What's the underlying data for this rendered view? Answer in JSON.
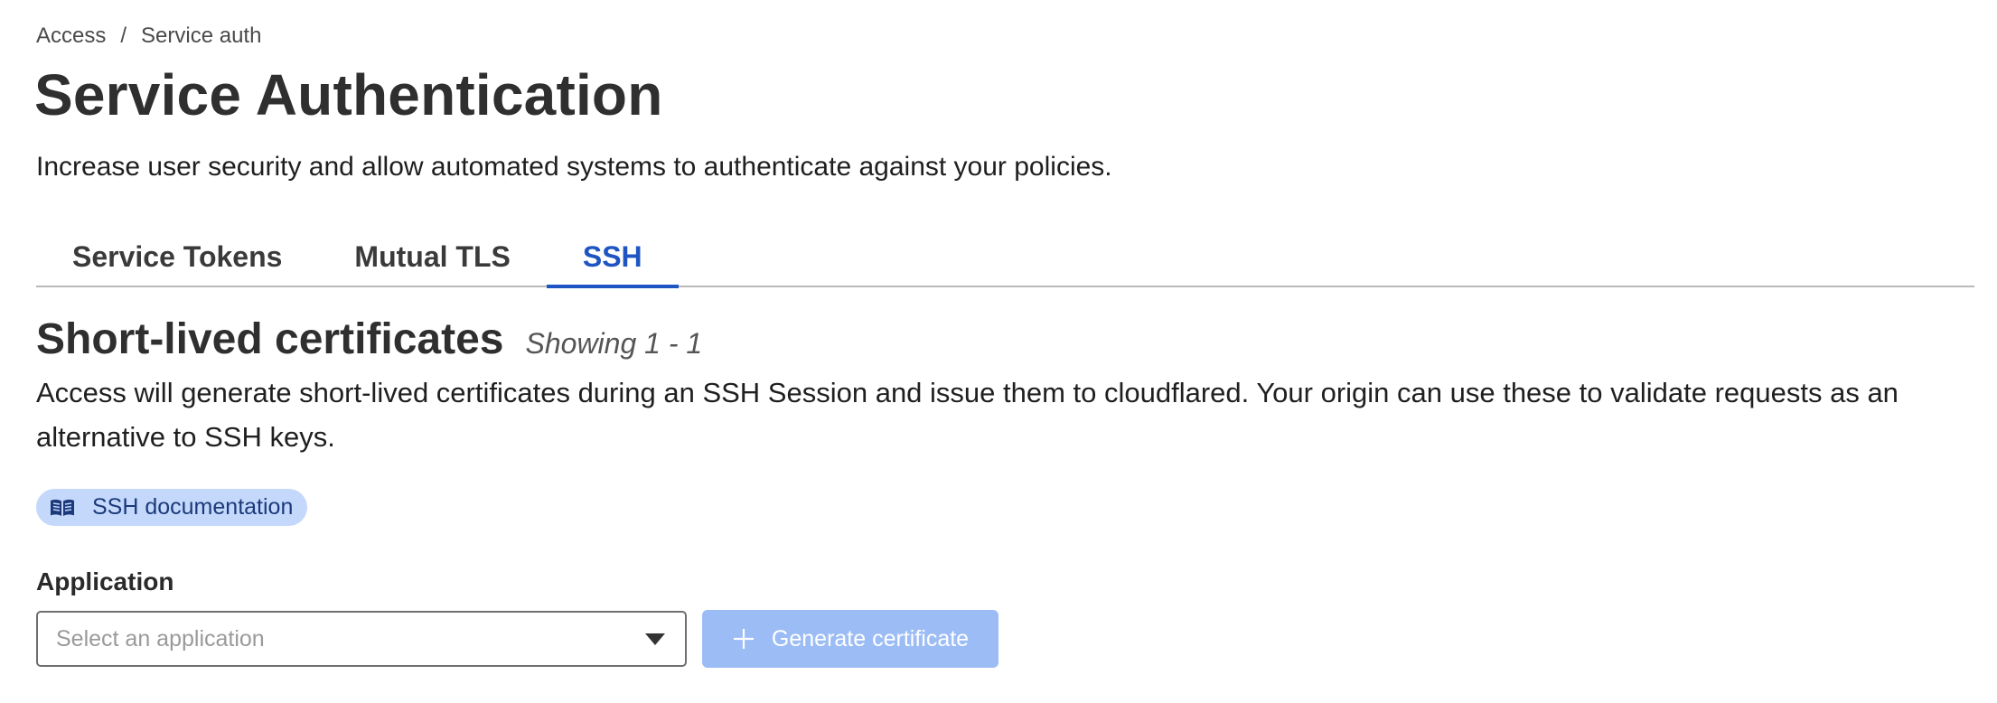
{
  "breadcrumb": {
    "items": [
      "Access",
      "Service auth"
    ],
    "separator": "/"
  },
  "page": {
    "title": "Service Authentication",
    "subtitle": "Increase user security and allow automated systems to authenticate against your policies."
  },
  "tabs": [
    {
      "label": "Service Tokens",
      "active": false
    },
    {
      "label": "Mutual TLS",
      "active": false
    },
    {
      "label": "SSH",
      "active": true
    }
  ],
  "section": {
    "title": "Short-lived certificates",
    "showing": "Showing 1 - 1",
    "description": "Access will generate short-lived certificates during an SSH Session and issue them to cloudflared. Your origin can use these to validate requests as an alternative to SSH keys."
  },
  "doc_link": {
    "label": "SSH documentation",
    "icon": "book-icon"
  },
  "form": {
    "application_label": "Application",
    "application_placeholder": "Select an application",
    "generate_button_label": "Generate certificate",
    "generate_button_icon": "plus-icon"
  },
  "colors": {
    "accent": "#1f55c2",
    "button_disabled_bg": "#9cbcf6",
    "pill_bg": "#c3d8fb",
    "pill_text": "#1c3a7a"
  }
}
